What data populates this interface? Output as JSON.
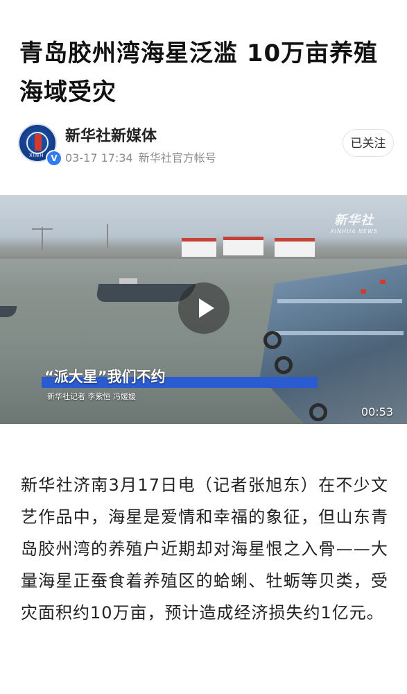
{
  "article": {
    "title": "青岛胶州湾海星泛滥 10万亩养殖海域受灾"
  },
  "author": {
    "name": "新华社新媒体",
    "date": "03-17 17:34",
    "account_type": "新华社官方帐号",
    "avatar_text": "XINH",
    "verified_badge": "V",
    "follow_label": "已关注"
  },
  "video": {
    "watermark_cn": "新华社",
    "watermark_en": "XINHUA NEWS",
    "caption_title": "“派大星”我们不约",
    "caption_sub": "新华社记者 李紫恒 冯媛媛",
    "duration": "00:53"
  },
  "content": {
    "paragraph": "新华社济南3月17日电（记者张旭东）在不少文艺作品中，海星是爱情和幸福的象征，但山东青岛胶州湾的养殖户近期却对海星恨之入骨——大量海星正蚕食着养殖区的蛤蜊、牡蛎等贝类，受灾面积约10万亩，预计造成经济损失约1亿元。"
  },
  "colors": {
    "caption_bar": "#2a5bd1",
    "verified": "#2f7cf6"
  }
}
